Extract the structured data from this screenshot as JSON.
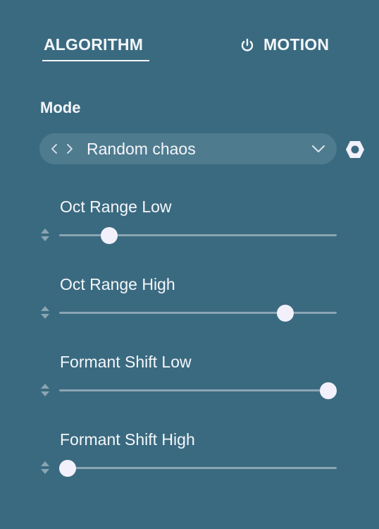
{
  "tabs": [
    {
      "label": "ALGORITHM",
      "active": true
    },
    {
      "label": "MOTION",
      "icon": "power-icon",
      "active": false
    }
  ],
  "mode": {
    "label": "Mode",
    "value": "Random chaos",
    "prev_icon": "chevron-left-icon",
    "next_icon": "chevron-right-icon",
    "dropdown_icon": "chevron-down-icon",
    "settings_icon": "hexagon-settings-icon"
  },
  "sliders": [
    {
      "label": "Oct Range Low",
      "value": 0.18
    },
    {
      "label": "Oct Range High",
      "value": 0.815
    },
    {
      "label": "Formant Shift Low",
      "value": 0.97
    },
    {
      "label": "Formant Shift High",
      "value": 0.03
    }
  ],
  "colors": {
    "background": "#3a6a80",
    "select_bg": "#4f7b8f",
    "track": "#8aa5b2",
    "thumb": "#f2f1fb",
    "text": "#f4f7fa"
  }
}
